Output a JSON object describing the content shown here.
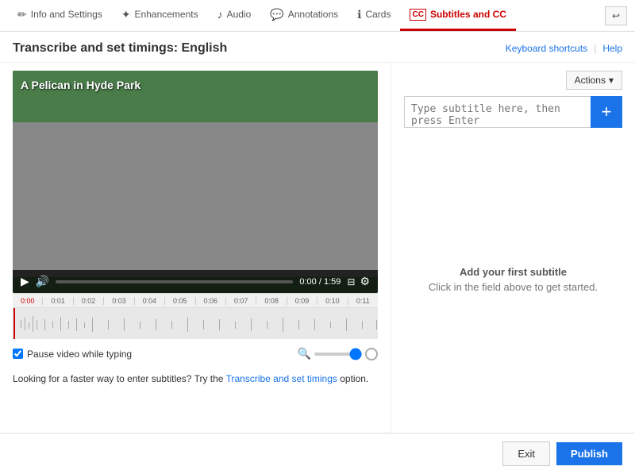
{
  "nav": {
    "tabs": [
      {
        "id": "info",
        "label": "Info and Settings",
        "icon": "✏",
        "active": false
      },
      {
        "id": "enhancements",
        "label": "Enhancements",
        "icon": "✦",
        "active": false
      },
      {
        "id": "audio",
        "label": "Audio",
        "icon": "♪",
        "active": false
      },
      {
        "id": "annotations",
        "label": "Annotations",
        "icon": "💬",
        "active": false
      },
      {
        "id": "cards",
        "label": "Cards",
        "icon": "ℹ",
        "active": false
      },
      {
        "id": "subtitles",
        "label": "Subtitles and CC",
        "icon": "CC",
        "active": true
      }
    ],
    "back_icon": "↩"
  },
  "page": {
    "title": "Transcribe and set timings: English",
    "keyboard_shortcuts": "Keyboard shortcuts",
    "divider": "|",
    "help": "Help"
  },
  "video": {
    "title": "A Pelican in Hyde Park",
    "time_current": "0:00",
    "time_total": "1:59",
    "time_display": "0:00 / 1:59"
  },
  "timeline": {
    "ticks": [
      "0:01",
      "0:02",
      "0:03",
      "0:04",
      "0:05",
      "0:06",
      "0:07",
      "0:08",
      "0:09",
      "0:10",
      "0:11"
    ]
  },
  "options": {
    "pause_label": "Pause video while typing",
    "pause_checked": true
  },
  "promo": {
    "text1": "Looking for a faster way to enter subtitles? Try the",
    "link_text": "Transcribe and set timings",
    "text2": "option."
  },
  "subtitle_panel": {
    "actions_label": "Actions",
    "actions_arrow": "▾",
    "input_placeholder": "Type subtitle here, then press Enter",
    "add_icon": "+",
    "empty_title": "Add your first subtitle",
    "empty_hint": "Click in the field above to get started."
  },
  "footer": {
    "exit_label": "Exit",
    "publish_label": "Publish"
  },
  "colors": {
    "accent_blue": "#1a73e8",
    "accent_red": "#cc0000"
  }
}
